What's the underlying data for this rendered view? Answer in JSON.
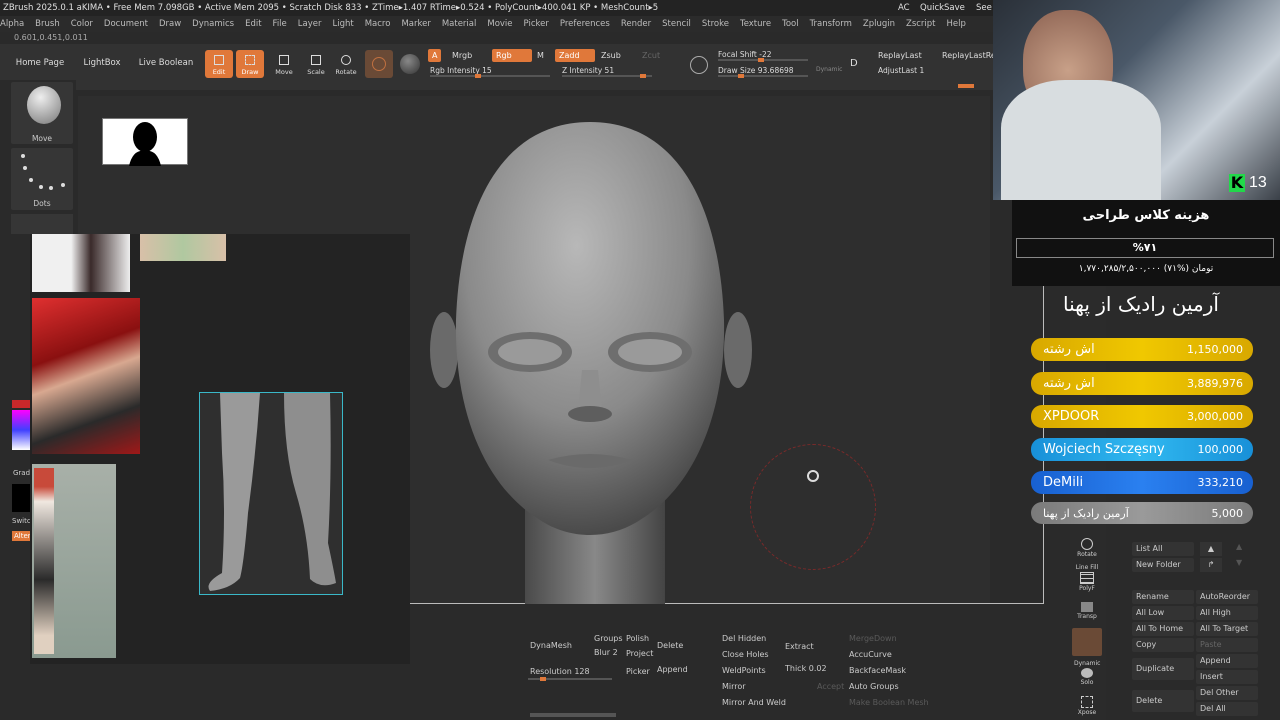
{
  "titlebar": "ZBrush 2025.0.1   aKIMA   • Free Mem 7.098GB • Active Mem 2095 • Scratch Disk 833 • ZTime▸1.407 RTime▸0.524 • PolyCount▸400.041 KP • MeshCount▸5",
  "titlebar_right": {
    "ac": "AC",
    "quicksave": "QuickSave",
    "see": "See"
  },
  "menu": [
    "Alpha",
    "Brush",
    "Color",
    "Document",
    "Draw",
    "Dynamics",
    "Edit",
    "File",
    "Layer",
    "Light",
    "Macro",
    "Marker",
    "Material",
    "Movie",
    "Picker",
    "Preferences",
    "Render",
    "Stencil",
    "Stroke",
    "Texture",
    "Tool",
    "Transform",
    "Zplugin",
    "Zscript",
    "Help"
  ],
  "coords": "0.601,0.451,0.011",
  "nav": {
    "home": "Home Page",
    "lightbox": "LightBox",
    "live_boolean": "Live Boolean"
  },
  "tools": {
    "edit": "Edit",
    "draw": "Draw",
    "move": "Move",
    "scale": "Scale",
    "rotate": "Rotate"
  },
  "shelf": {
    "a": "A",
    "mrgb": "Mrgb",
    "rgb": "Rgb",
    "m": "M",
    "zadd": "Zadd",
    "zsub": "Zsub",
    "zcut": "Zcut",
    "rgb_intensity": "Rgb Intensity 15",
    "z_intensity": "Z Intensity 51",
    "focal_shift": "Focal Shift -22",
    "draw_size": "Draw Size 93.68698",
    "dynamic": "Dynamic",
    "replay_last": "ReplayLast",
    "replay_last_rel": "ReplayLastRel",
    "adjust_last": "AdjustLast 1"
  },
  "left_shelf": {
    "move": "Move",
    "dots": "Dots",
    "grad": "Grad",
    "switch": "Switc",
    "alter": "Alter"
  },
  "bottom": {
    "dynamesh": "DynaMesh",
    "groups": "Groups",
    "polish": "Polish",
    "blur": "Blur 2",
    "project": "Project",
    "delete": "Delete",
    "resolution": "Resolution 128",
    "picker": "Picker",
    "append": "Append",
    "del_hidden": "Del Hidden",
    "close_holes": "Close Holes",
    "weld_points": "WeldPoints",
    "mirror": "Mirror",
    "mirror_and_weld": "Mirror And Weld",
    "extract": "Extract",
    "thick": "Thick 0.02",
    "accept": "Accept",
    "merge_down": "MergeDown",
    "accu_curve": "AccuCurve",
    "backface_mask": "BackfaceMask",
    "auto_groups": "Auto Groups",
    "make_boolean_mesh": "Make Boolean Mesh"
  },
  "right_strip": {
    "rotate": "Rotate",
    "line_fill": "Line Fill",
    "polyf": "PolyF",
    "transp": "Transp",
    "dynamic": "Dynamic",
    "solo": "Solo",
    "xpose": "Xpose"
  },
  "subtools": {
    "list_all": "List All",
    "new_folder": "New Folder",
    "rename": "Rename",
    "auto_reorder": "AutoReorder",
    "all_low": "All Low",
    "all_high": "All High",
    "all_to_home": "All To Home",
    "all_to_target": "All To Target",
    "copy": "Copy",
    "paste": "Paste",
    "duplicate": "Duplicate",
    "append": "Append",
    "insert": "Insert",
    "delete": "Delete",
    "del_other": "Del Other",
    "del_all": "Del All"
  },
  "overlay": {
    "kick_count": "13",
    "goal_title": "هزینه کلاس طراحی",
    "goal_percent": "%۷۱",
    "goal_amount": "۱,۷۷۰,۲۸۵/۲,۵۰۰,۰۰۰ تومان (%۷۱)",
    "top_donor": "آرمین رادیک از پهنا",
    "donations": [
      {
        "name": "اش رشته",
        "amount": "1,150,000",
        "color": "#e8b800"
      },
      {
        "name": "اش رشته",
        "amount": "3,889,976",
        "color": "#e8b800"
      },
      {
        "name": "XPDOOR",
        "amount": "3,000,000",
        "color": "#e8b800"
      },
      {
        "name": "Wojciech Szczęsny",
        "amount": "100,000",
        "color": "#1ea2e6"
      },
      {
        "name": "DeMili",
        "amount": "333,210",
        "color": "#1f6fe0"
      },
      {
        "name": "آرمین رادیک از پهنا",
        "amount": "5,000",
        "color": "#8a8a8a"
      }
    ]
  }
}
